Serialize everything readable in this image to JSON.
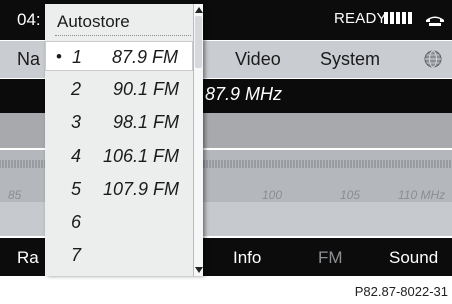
{
  "topbar": {
    "time": "04:",
    "status": "READY",
    "signal_bars": 5,
    "phone_icon": "phone-icon"
  },
  "menu": {
    "items": [
      "Na",
      "Video",
      "System"
    ],
    "globe_icon": "globe-icon"
  },
  "frequency_display": "87.9 MHz",
  "scale": {
    "labels": [
      "85",
      "100",
      "105",
      "110 MHz"
    ]
  },
  "bottom": {
    "items": [
      "Ra",
      "Info",
      "FM",
      "Sound"
    ],
    "active": "FM"
  },
  "dropdown": {
    "title": "Autostore",
    "selected_bullet": "•",
    "items": [
      {
        "num": "1",
        "freq": "87.9 FM"
      },
      {
        "num": "2",
        "freq": "90.1 FM"
      },
      {
        "num": "3",
        "freq": "98.1 FM"
      },
      {
        "num": "4",
        "freq": "106.1 FM"
      },
      {
        "num": "5",
        "freq": "107.9 FM"
      },
      {
        "num": "6",
        "freq": ""
      },
      {
        "num": "7",
        "freq": ""
      }
    ]
  },
  "figure_ref": "P82.87-8022-31"
}
